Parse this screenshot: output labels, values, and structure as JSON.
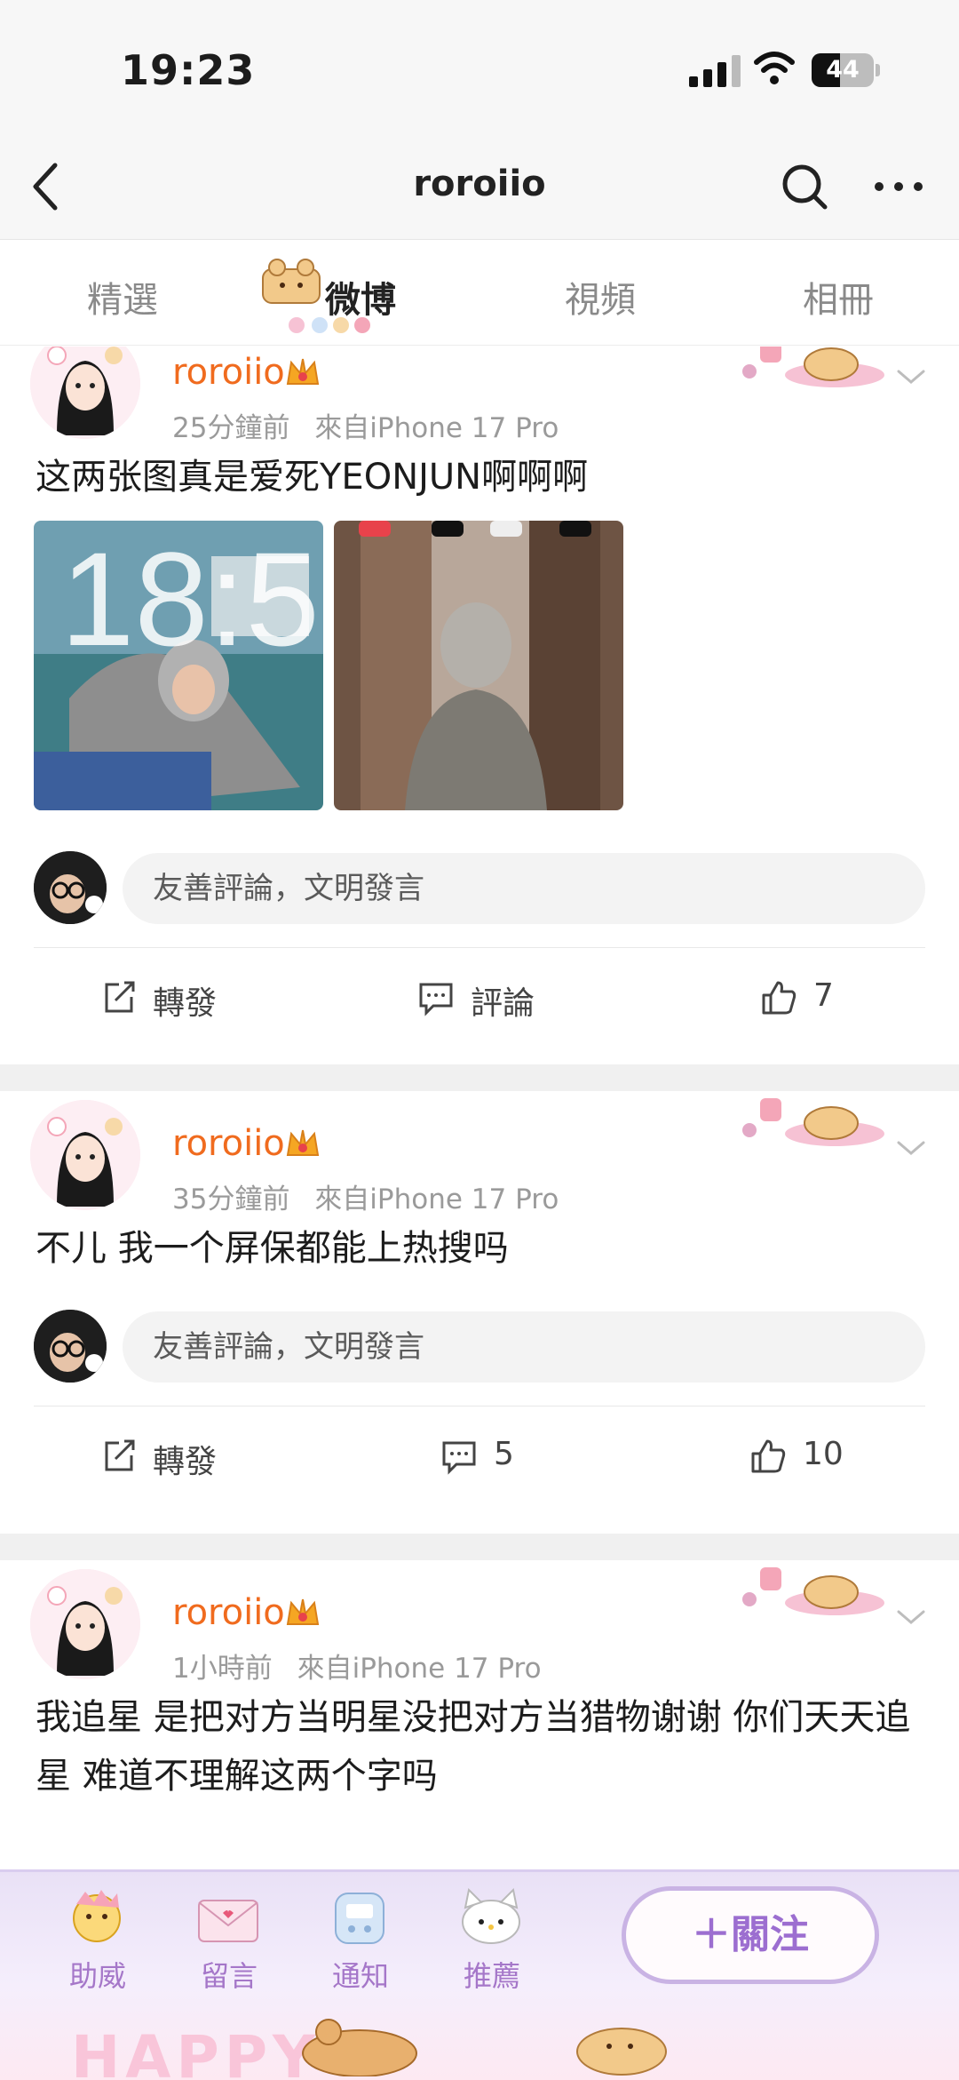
{
  "status_bar": {
    "time": "19:23",
    "battery": "44"
  },
  "nav": {
    "title": "roroiio"
  },
  "tabs": [
    {
      "label": "精選"
    },
    {
      "label": "微博"
    },
    {
      "label": "視頻"
    },
    {
      "label": "相冊"
    }
  ],
  "posts": [
    {
      "username": "roroiio",
      "time": "25分鐘前",
      "source": "來自iPhone 17 Pro",
      "text": "这两张图真是爱死YEONJUN啊啊啊",
      "photos": [
        "photo-1",
        "photo-2"
      ],
      "comment_placeholder": "友善評論，文明發言",
      "repost_label": "轉發",
      "comment_label": "評論",
      "like_count": "7"
    },
    {
      "username": "roroiio",
      "time": "35分鐘前",
      "source": "來自iPhone 17 Pro",
      "text": "不儿 我一个屏保都能上热搜吗",
      "comment_placeholder": "友善評論，文明發言",
      "repost_label": "轉發",
      "comment_count": "5",
      "like_count": "10"
    },
    {
      "username": "roroiio",
      "time": "1小時前",
      "source": "來自iPhone 17 Pro",
      "text": "我追星 是把对方当明星没把对方当猎物谢谢 你们天天追星 难道不理解这两个字吗"
    }
  ],
  "bottom_bar": {
    "items": [
      {
        "label": "助威"
      },
      {
        "label": "留言"
      },
      {
        "label": "通知"
      },
      {
        "label": "推薦"
      }
    ],
    "follow_label": "＋關注",
    "decor_text": "HAPPY"
  },
  "colors": {
    "username": "#f06b1e",
    "meta": "#9a9a9a",
    "bottom_accent": "#a577c9"
  }
}
